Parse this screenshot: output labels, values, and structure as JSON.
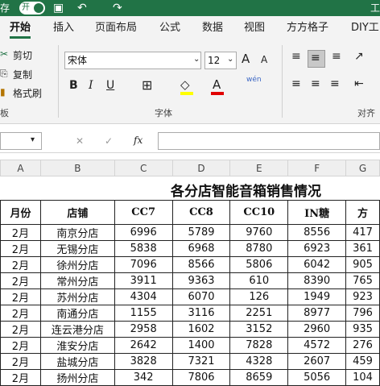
{
  "titlebar": {
    "autosave_label": "存",
    "toggle_label": "开",
    "right_label": "工"
  },
  "tabs": [
    "开始",
    "插入",
    "页面布局",
    "公式",
    "数据",
    "视图",
    "方方格子",
    "DIY工"
  ],
  "ribbon": {
    "clipboard": {
      "cut": "剪切",
      "copy": "复制",
      "format_painter": "格式刷",
      "group_label": "板"
    },
    "font": {
      "name": "宋体",
      "size": "12",
      "group_label": "字体",
      "bold": "B",
      "italic": "I",
      "underline": "U",
      "grow": "A",
      "shrink": "A",
      "phonetic": "wén"
    },
    "align": {
      "group_label": "对齐"
    }
  },
  "formula_bar": {
    "name_box": "",
    "fx": "fx",
    "formula": ""
  },
  "columns": [
    "A",
    "B",
    "C",
    "D",
    "E",
    "F",
    "G"
  ],
  "sheet": {
    "title": "各分店智能音箱销售情况",
    "headers": [
      "月份",
      "店铺",
      "CC7",
      "CC8",
      "CC10",
      "IN糖",
      "方"
    ],
    "rows": [
      [
        "2月",
        "南京分店",
        "6996",
        "5789",
        "9760",
        "8556",
        "417"
      ],
      [
        "2月",
        "无锡分店",
        "5838",
        "6968",
        "8780",
        "6923",
        "361"
      ],
      [
        "2月",
        "徐州分店",
        "7096",
        "8566",
        "5806",
        "6042",
        "905"
      ],
      [
        "2月",
        "常州分店",
        "3911",
        "9363",
        "610",
        "8390",
        "765"
      ],
      [
        "2月",
        "苏州分店",
        "4304",
        "6070",
        "126",
        "1949",
        "923"
      ],
      [
        "2月",
        "南通分店",
        "1155",
        "3116",
        "2251",
        "8977",
        "796"
      ],
      [
        "2月",
        "连云港分店",
        "2958",
        "1602",
        "3152",
        "2960",
        "935"
      ],
      [
        "2月",
        "淮安分店",
        "2642",
        "1400",
        "7828",
        "4572",
        "276"
      ],
      [
        "2月",
        "盐城分店",
        "3828",
        "7321",
        "4328",
        "2607",
        "459"
      ],
      [
        "2月",
        "扬州分店",
        "342",
        "7806",
        "8659",
        "5056",
        "104"
      ]
    ]
  }
}
